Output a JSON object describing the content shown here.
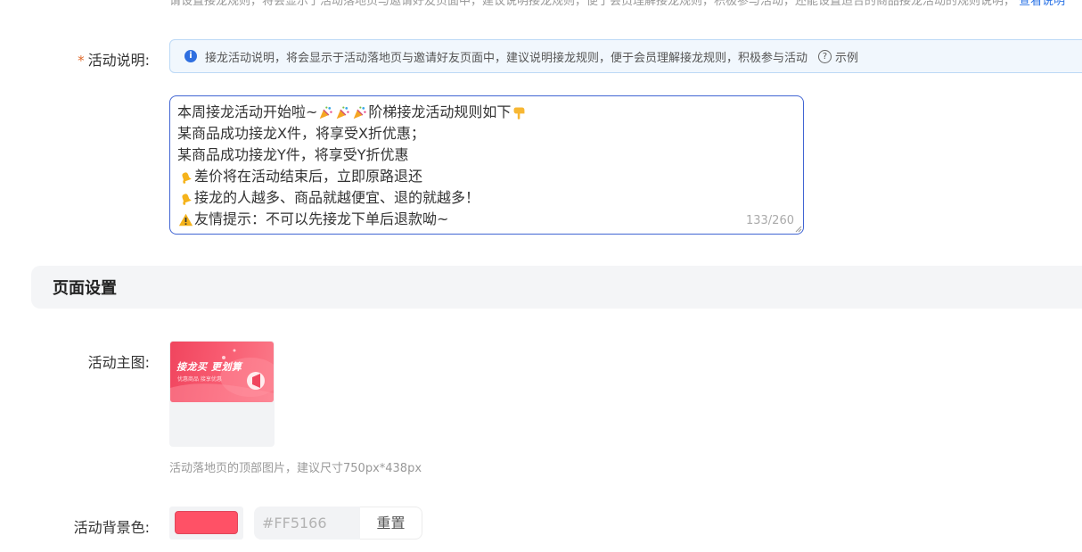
{
  "top_line": {
    "text": "请设置接龙规则，将会显示于活动落地页与邀请好友页面中，建议说明接龙规则，便于会员理解接龙规则，积极参与活动，还能设置适合的商品接龙活动的规则说明，",
    "link": "查看说明"
  },
  "description": {
    "required_mark": "*",
    "label": "活动说明:",
    "tip": "接龙活动说明，将会显示于活动落地页与邀请好友页面中，建议说明接龙规则，便于会员理解接龙规则，积极参与活动",
    "example_label": "示例",
    "lines": [
      {
        "prefix": "",
        "text": "本周接龙活动开始啦~",
        "icons": [
          "party-popper-icon",
          "party-popper-icon",
          "party-popper-icon"
        ],
        "suffix": "阶梯接龙活动规则如下",
        "end_icon": "pointing-down-icon"
      },
      {
        "text": "某商品成功接龙X件，将享受X折优惠；"
      },
      {
        "text": "某商品成功接龙Y件，将享受Y折优惠"
      },
      {
        "icon": "bell-icon",
        "text": "差价将在活动结束后，立即原路退还"
      },
      {
        "icon": "bell-icon",
        "text": "接龙的人越多、商品就越便宜、退的就越多！"
      },
      {
        "icon": "warning-icon",
        "text": "友情提示：不可以先接龙下单后退款呦~"
      }
    ],
    "counter": "133/260"
  },
  "section": {
    "title": "页面设置"
  },
  "main_image": {
    "label": "活动主图:",
    "banner_title": "接龙买 更划算",
    "banner_sub": "优惠商品 接享优惠",
    "hint": "活动落地页的顶部图片，建议尺寸750px*438px"
  },
  "bg_color": {
    "label": "活动背景色:",
    "value": "#FF5166",
    "placeholder": "#FF5166",
    "reset_label": "重置",
    "swatch_color": "#FF5166"
  },
  "colors": {
    "accent": "#4165D3",
    "info": "#2F6FE0",
    "required": "#E06A2C"
  }
}
